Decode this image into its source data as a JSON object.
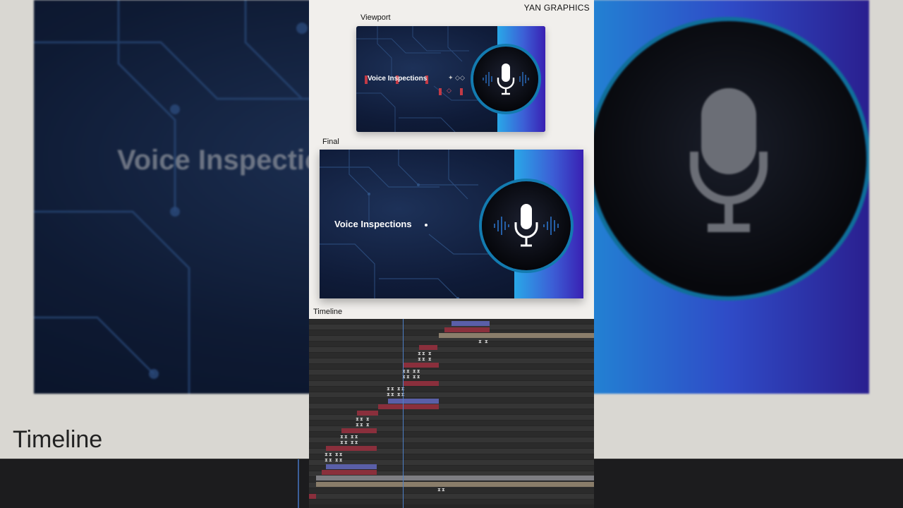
{
  "brand": "YAN GRAPHICS",
  "labels": {
    "viewport": "Viewport",
    "final": "Final",
    "timeline": "Timeline"
  },
  "card": {
    "title": "Voice Inspections"
  },
  "background": {
    "title": "Voice Inspectio",
    "timeline_label": "Timeline"
  },
  "colors": {
    "accent_light": "#29a8e8",
    "accent_mid": "#3c5fd6",
    "accent_dark": "#3920b3",
    "card_bg": "#0f1b38",
    "bar_red": "#8a2f3c",
    "bar_blue": "#5a5fa8",
    "bar_tan": "#8a7d6a",
    "bar_grey": "#7d7d82",
    "playhead": "#4d7fc7"
  },
  "icons": {
    "mic": "microphone-icon",
    "waveform": "waveform-icon"
  }
}
